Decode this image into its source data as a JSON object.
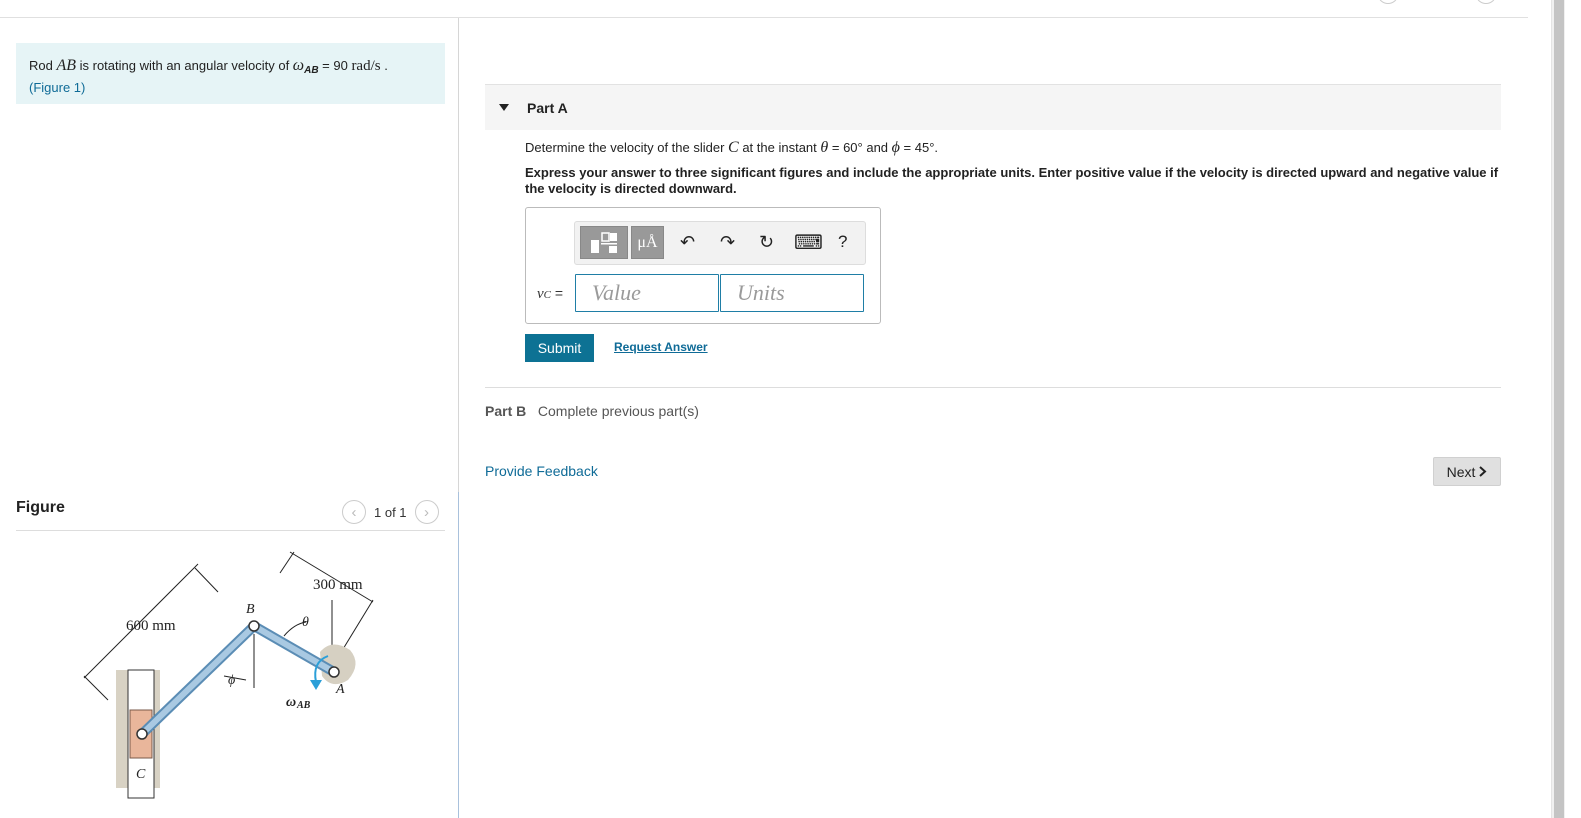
{
  "problem": {
    "prefix": "Rod ",
    "rod": "AB",
    "middle": " is rotating with an angular velocity of ",
    "omega": "ω",
    "omega_sub": "AB",
    "equals": " = 90 ",
    "unit": "rad/s",
    "suffix": " .",
    "figure_link": "(Figure 1)"
  },
  "figure": {
    "title": "Figure",
    "counter": "1 of 1",
    "labels": {
      "dim_600": "600 mm",
      "dim_300": "300 mm",
      "B": "B",
      "A": "A",
      "C": "C",
      "theta": "θ",
      "phi": "ϕ",
      "omega": "ω",
      "omega_sub": "AB"
    }
  },
  "partA": {
    "title": "Part A",
    "question_prefix": "Determine the velocity of the slider ",
    "question_C": "C",
    "question_mid": " at the instant ",
    "question_theta": "θ",
    "question_theta_val": " = 60° ",
    "question_and": " and ",
    "question_phi": "ϕ",
    "question_phi_val": " = 45°.",
    "instructions": "Express your answer to three significant figures and include the appropriate units. Enter positive value if the velocity is directed upward and negative value if the velocity is directed downward.",
    "var_label": "vC =",
    "var_v": "v",
    "var_sub": "C",
    "var_eq": " =",
    "value_placeholder": "Value",
    "units_placeholder": "Units",
    "toolbar": {
      "templates": "templates",
      "units_btn": "μÅ",
      "undo": "↶",
      "redo": "↷",
      "reset": "↻",
      "keyboard": "⌨",
      "help": "?"
    },
    "submit_label": "Submit",
    "request_label": "Request Answer"
  },
  "partB": {
    "title": "Part B",
    "status": "Complete previous part(s)"
  },
  "footer": {
    "feedback_label": "Provide Feedback",
    "next_label": "Next"
  },
  "colors": {
    "accent": "#0d7294",
    "problem_bg": "#e6f4f6",
    "link": "#0f6b97"
  }
}
